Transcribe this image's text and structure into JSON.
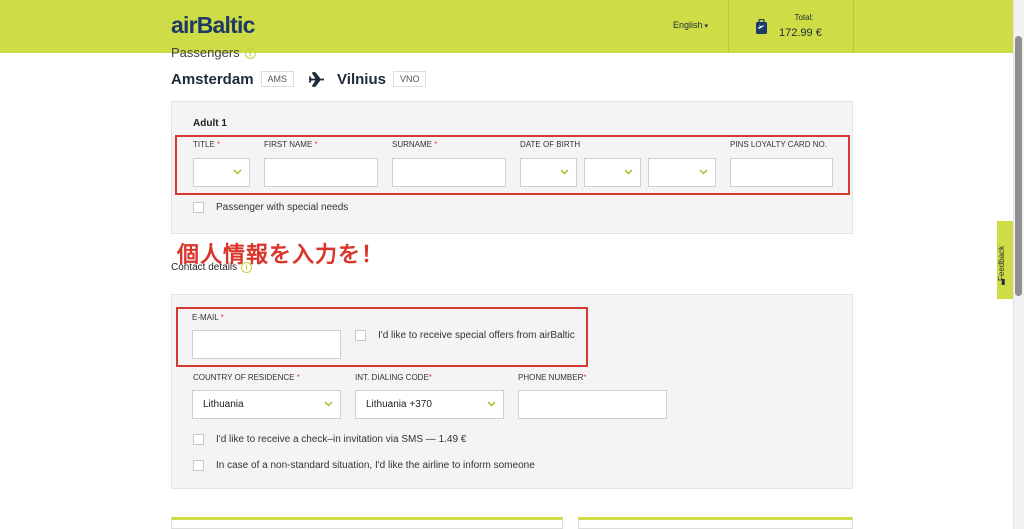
{
  "header": {
    "logo": "airBaltic",
    "language": "English",
    "total_label": "Total:",
    "total_value": "172.99 €",
    "brand_color": "#cedc45"
  },
  "feedback": {
    "label": "Feedback"
  },
  "passengers_section": {
    "title": "Passengers"
  },
  "route": {
    "from_city": "Amsterdam",
    "from_code": "AMS",
    "to_city": "Vilnius",
    "to_code": "VNO"
  },
  "passenger_form": {
    "title": "Adult 1",
    "labels": {
      "title": "TITLE",
      "first_name": "FIRST NAME",
      "surname": "SURNAME",
      "date_of_birth": "DATE OF BIRTH",
      "loyalty": "PINS LOYALTY CARD NO."
    },
    "required_mark": "*",
    "special_needs": "Passenger with special needs"
  },
  "annotation": {
    "text": "個人情報を入力を！",
    "color": "#d9352b"
  },
  "contact": {
    "title": "Contact details",
    "email_label": "E-MAIL",
    "offers_label": "I'd like to receive special offers from airBaltic",
    "country_label": "COUNTRY OF RESIDENCE",
    "country_value": "Lithuania",
    "dialing_label": "INT. DIALING CODE",
    "dialing_value": "Lithuania +370",
    "phone_label": "PHONE NUMBER",
    "sms_option": "I'd like to receive a check–in invitation via SMS — 1.49 €",
    "nonstandard_option": "In case of a non-standard situation, I'd like the airline to inform someone"
  }
}
